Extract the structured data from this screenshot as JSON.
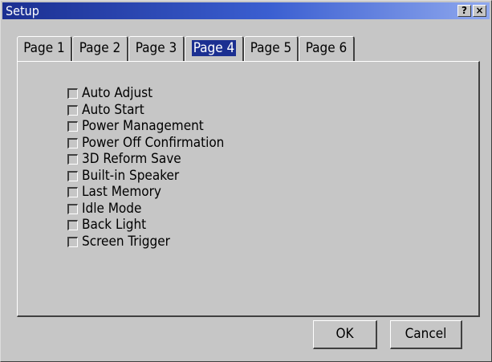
{
  "window": {
    "title": "Setup"
  },
  "titlebar_buttons": {
    "help": "?",
    "close": "×"
  },
  "tabs": [
    {
      "label": "Page 1",
      "selected": false
    },
    {
      "label": "Page 2",
      "selected": false
    },
    {
      "label": "Page 3",
      "selected": false
    },
    {
      "label": "Page 4",
      "selected": true
    },
    {
      "label": "Page 5",
      "selected": false
    },
    {
      "label": "Page 6",
      "selected": false
    }
  ],
  "options": [
    {
      "label": "Auto Adjust",
      "checked": false
    },
    {
      "label": "Auto Start",
      "checked": false
    },
    {
      "label": "Power Management",
      "checked": false
    },
    {
      "label": "Power Off Confirmation",
      "checked": false
    },
    {
      "label": "3D Reform Save",
      "checked": false
    },
    {
      "label": "Built-in Speaker",
      "checked": false
    },
    {
      "label": "Last Memory",
      "checked": false
    },
    {
      "label": "Idle Mode",
      "checked": false
    },
    {
      "label": "Back Light",
      "checked": false
    },
    {
      "label": "Screen Trigger",
      "checked": false
    }
  ],
  "buttons": {
    "ok": "OK",
    "cancel": "Cancel"
  },
  "colors": {
    "face": "#c6c6c6",
    "title_start": "#1b2f91",
    "title_end": "#8fa8ee",
    "selection": "#1b2f91"
  }
}
